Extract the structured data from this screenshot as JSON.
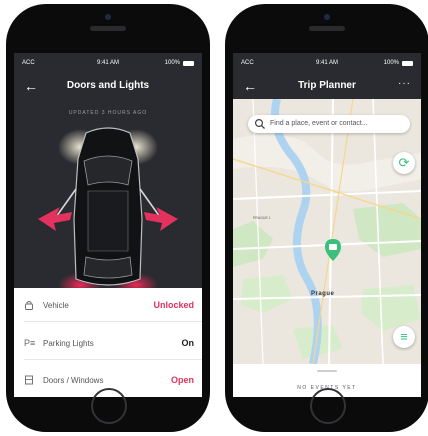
{
  "phone1": {
    "status": {
      "carrier": "ACC",
      "time": "9:41 AM",
      "battery": "100%"
    },
    "nav": {
      "title": "Doors and Lights"
    },
    "updated_text": "UPDATED 3 HOURS AGO",
    "rows": [
      {
        "icon": "lock-icon",
        "label": "Vehicle",
        "value": "Unlocked",
        "value_color": "#e2325d"
      },
      {
        "icon": "parking-icon",
        "label": "Parking Lights",
        "value": "On",
        "value_color": "#222222"
      },
      {
        "icon": "door-icon",
        "label": "Doors / Windows",
        "value": "Open",
        "value_color": "#e2325d"
      }
    ]
  },
  "phone2": {
    "status": {
      "carrier": "ACC",
      "time": "9:41 AM",
      "battery": "100%"
    },
    "nav": {
      "title": "Trip Planner"
    },
    "search": {
      "placeholder": "Find a place, event or contact..."
    },
    "map_labels": {
      "city": "Prague",
      "district": "PRAGUE 1"
    },
    "sheet_text": "NO EVENTS YET"
  },
  "colors": {
    "accent": "#e2325d",
    "brand_green": "#3bbf7a",
    "dark_bg": "#2a2b30"
  }
}
